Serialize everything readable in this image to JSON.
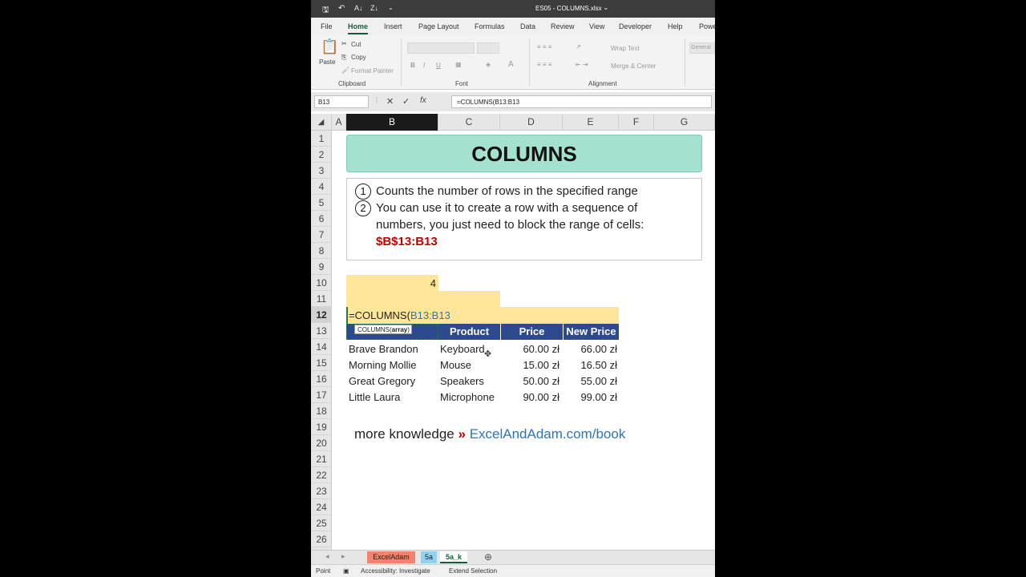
{
  "titlebar": {
    "qat_icons": [
      "save-icon",
      "undo-icon",
      "sort-az-icon",
      "sort-za-icon",
      "customize-icon"
    ],
    "title": "ES05 - COLUMNS.xlsx"
  },
  "ribbon_tabs": [
    "File",
    "Home",
    "Insert",
    "Page Layout",
    "Formulas",
    "Data",
    "Review",
    "View",
    "Developer",
    "Help",
    "Powe"
  ],
  "ribbon": {
    "paste": "Paste",
    "cut": "Cut",
    "copy": "Copy",
    "format_painter": "Format Painter",
    "clipboard": "Clipboard",
    "font": "Font",
    "font_bold": "B",
    "font_italic": "I",
    "font_underline": "U",
    "wrap_text": "Wrap Text",
    "merge_center": "Merge & Center",
    "alignment": "Alignment",
    "general": "General"
  },
  "formula_bar": {
    "name_box": "B13",
    "formula": "=COLUMNS(B13:B13"
  },
  "columns": [
    "A",
    "B",
    "C",
    "D",
    "E",
    "F",
    "G"
  ],
  "rows": [
    "1",
    "2",
    "3",
    "4",
    "5",
    "6",
    "7",
    "8",
    "9",
    "10",
    "11",
    "12",
    "13",
    "14",
    "15",
    "16",
    "17",
    "18",
    "19",
    "20",
    "21",
    "22",
    "23",
    "24",
    "25",
    "26"
  ],
  "sheet": {
    "title": "COLUMNS",
    "note1_num": "1",
    "note1": "Counts the number of rows in the specified range",
    "note2_num": "2",
    "note2a": "You can use it to create a row with a sequence of",
    "note2b": "numbers, you just need to block the range of cells:",
    "note2c": "$B$13:B13",
    "b10": "4",
    "b12_prefix": "=COLUMNS(",
    "b12_ref": "B13:B13",
    "tooltip_fn": "COLUMNS(",
    "tooltip_arg": "array",
    "tooltip_end": ")",
    "table_headers": [
      "Product",
      "Price",
      "New Price"
    ],
    "table_rows": [
      [
        "Brave Brandon",
        "Keyboard",
        "60.00 zł",
        "66.00 zł"
      ],
      [
        "Morning Mollie",
        "Mouse",
        "15.00 zł",
        "16.50 zł"
      ],
      [
        "Great Gregory",
        "Speakers",
        "50.00 zł",
        "55.00 zł"
      ],
      [
        "Little Laura",
        "Microphone",
        "90.00 zł",
        "99.00 zł"
      ]
    ],
    "promo_text": "more knowledge",
    "promo_arrow": "»",
    "promo_link": "ExcelAndAdam.com/book"
  },
  "sheet_tabs": [
    {
      "label": "ExcelAdam",
      "color": "#f4826c"
    },
    {
      "label": "5a",
      "color": "#8fd3f4"
    },
    {
      "label": "5a_k",
      "color": "#ffffff"
    }
  ],
  "status": {
    "mode": "Point",
    "accessibility": "Accessibility: Investigate",
    "extend": "Extend Selection"
  }
}
